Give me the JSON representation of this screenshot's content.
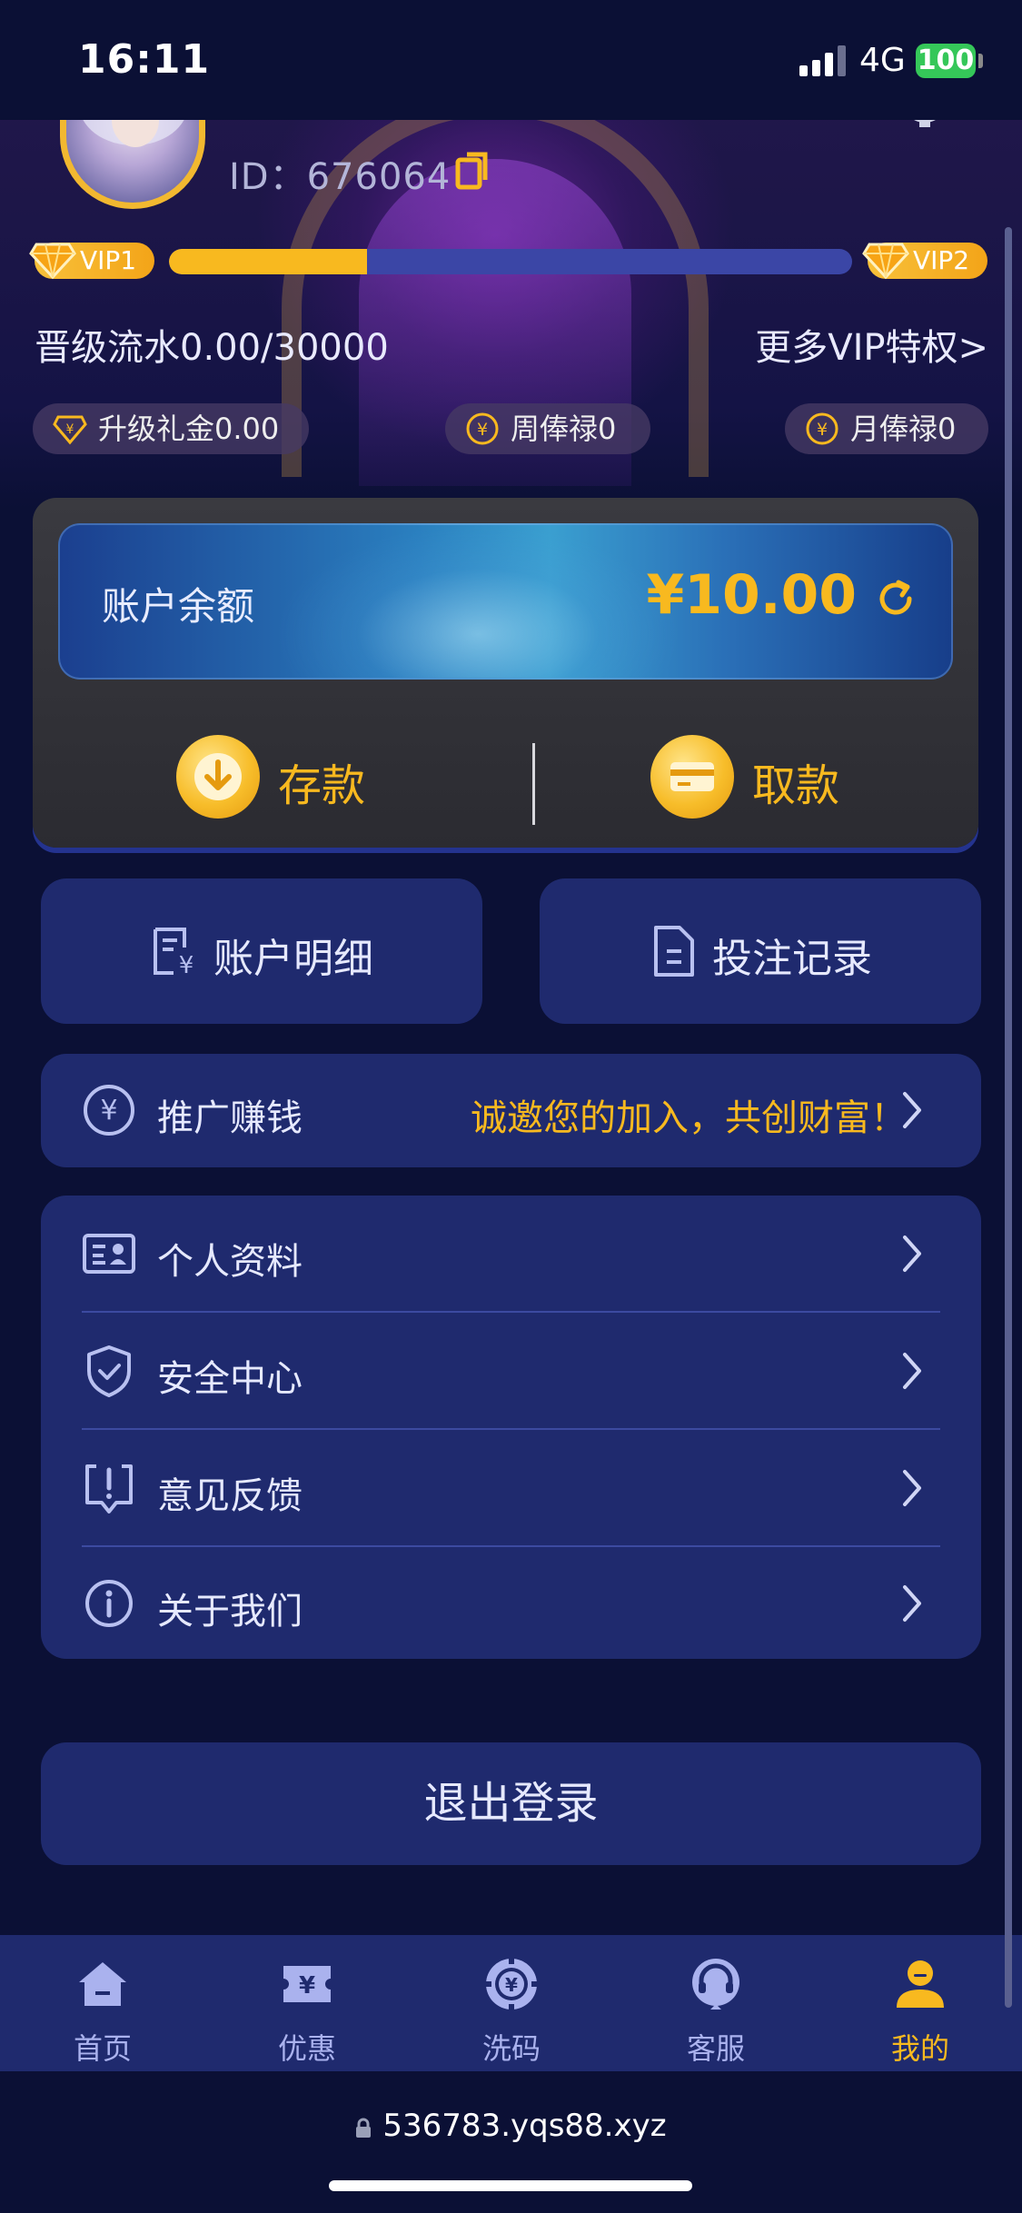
{
  "status_bar": {
    "time": "16:11",
    "network": "4G",
    "battery": "100"
  },
  "profile": {
    "id_text": "ID：676064"
  },
  "vip": {
    "current_level": "VIP1",
    "next_level": "VIP2",
    "progress_fraction": 0.29,
    "flow_text": "晋级流水0.00/30000",
    "more_link": "更多VIP特权>"
  },
  "rewards": [
    {
      "label": "升级礼金0.00",
      "icon": "diamond-icon"
    },
    {
      "label": "周俸禄0",
      "icon": "yen-coin-icon"
    },
    {
      "label": "月俸禄0",
      "icon": "yen-coin-icon"
    }
  ],
  "wallet": {
    "balance_label": "账户余额",
    "balance_value": "¥10.00",
    "deposit_label": "存款",
    "withdraw_label": "取款"
  },
  "quick_buttons": {
    "account_detail": "账户明细",
    "bet_record": "投注记录"
  },
  "promo": {
    "label": "推广赚钱",
    "slogan": "诚邀您的加入，共创财富！"
  },
  "menu": {
    "profile": "个人资料",
    "security": "安全中心",
    "feedback": "意见反馈",
    "about": "关于我们"
  },
  "logout_label": "退出登录",
  "tabs": [
    {
      "label": "首页",
      "icon": "home-icon"
    },
    {
      "label": "优惠",
      "icon": "ticket-icon"
    },
    {
      "label": "洗码",
      "icon": "chip-icon"
    },
    {
      "label": "客服",
      "icon": "headset-icon"
    },
    {
      "label": "我的",
      "icon": "user-icon"
    }
  ],
  "active_tab": "我的",
  "browser": {
    "url": "536783.yqs88.xyz"
  },
  "colors": {
    "accent": "#f8b91f",
    "card": "#1f2a6e",
    "background": "#0b1035",
    "progress_track": "#3b46a6"
  }
}
